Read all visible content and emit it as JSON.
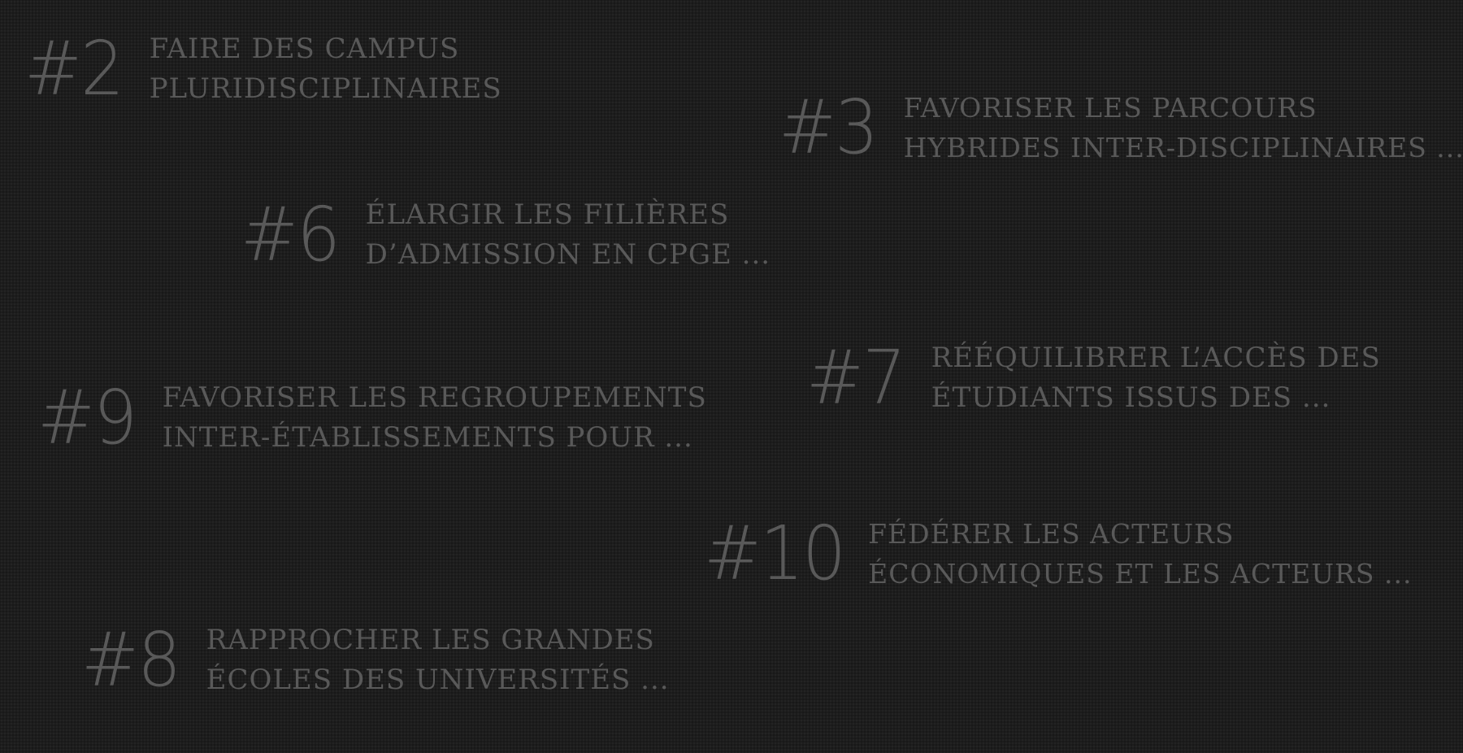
{
  "items": [
    {
      "number": "#2",
      "line1": "Faire des campus",
      "line2": "pluridisciplinaires"
    },
    {
      "number": "#3",
      "line1": "Favoriser les parcours",
      "line2": "hybrides inter-disciplinaires ..."
    },
    {
      "number": "#6",
      "line1": "Élargir les filières",
      "line2": "d’admission en CPGE ..."
    },
    {
      "number": "#7",
      "line1": "Rééquilibrer l’accès des",
      "line2": "étudiants issus des ..."
    },
    {
      "number": "#9",
      "line1": "Favoriser les regroupements",
      "line2": "inter-établissements pour ..."
    },
    {
      "number": "#10",
      "line1": "Fédérer les acteurs",
      "line2": "économiques et les acteurs ..."
    },
    {
      "number": "#8",
      "line1": "Rapprocher les grandes",
      "line2": "écoles des universités ..."
    }
  ],
  "colors": {
    "background": "#1d1d1d",
    "text": "#595959"
  }
}
